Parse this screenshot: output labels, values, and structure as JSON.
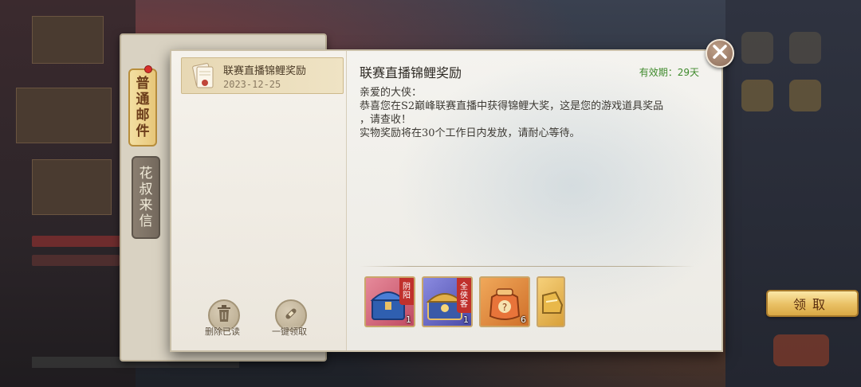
{
  "tabs": [
    {
      "label": "普通邮件",
      "chars": [
        "普",
        "通",
        "邮",
        "件"
      ],
      "active": true,
      "has_notification": true
    },
    {
      "label": "花叔来信",
      "chars": [
        "花",
        "叔",
        "来",
        "信"
      ],
      "active": false
    }
  ],
  "mail_list": [
    {
      "title": "联赛直播锦鲤奖励",
      "date": "2023-12-25",
      "selected": true,
      "icon": "envelope-icon"
    }
  ],
  "list_actions": {
    "delete_read": {
      "label": "删除已读",
      "icon": "trash-icon"
    },
    "claim_all": {
      "label": "一键领取",
      "icon": "scroll-icon"
    }
  },
  "mail": {
    "title": "联赛直播锦鲤奖励",
    "validity": "有效期：29天",
    "greeting": "亲爱的大侠：",
    "body_line1": "恭喜您在S2巅峰联赛直播中获得锦鲤大奖，这是您的游戏道具奖品",
    "body_line2": "，请查收！",
    "body_line3": "实物奖励将在30个工作日内发放，请耐心等待。"
  },
  "rewards": [
    {
      "name": "blue-chest",
      "count": "1",
      "tag": "阴阳",
      "tag_chars": [
        "阴",
        "阳"
      ],
      "bg": "#d86a7a"
    },
    {
      "name": "gold-chest",
      "count": "1",
      "tag": "全侠客",
      "tag_chars": [
        "全",
        "侠",
        "客"
      ],
      "bg": "#7a78c8"
    },
    {
      "name": "mystery-bag",
      "count": "6",
      "tag": "",
      "bg": "#e08a3a"
    },
    {
      "name": "gold-item",
      "count": "",
      "tag": "",
      "bg": "#e0a83a"
    }
  ],
  "claim_button": {
    "label": "领取"
  },
  "colors": {
    "validity": "#3f8a2c",
    "accent_gold": "#e9c064",
    "tag_red": "#c0302c"
  }
}
